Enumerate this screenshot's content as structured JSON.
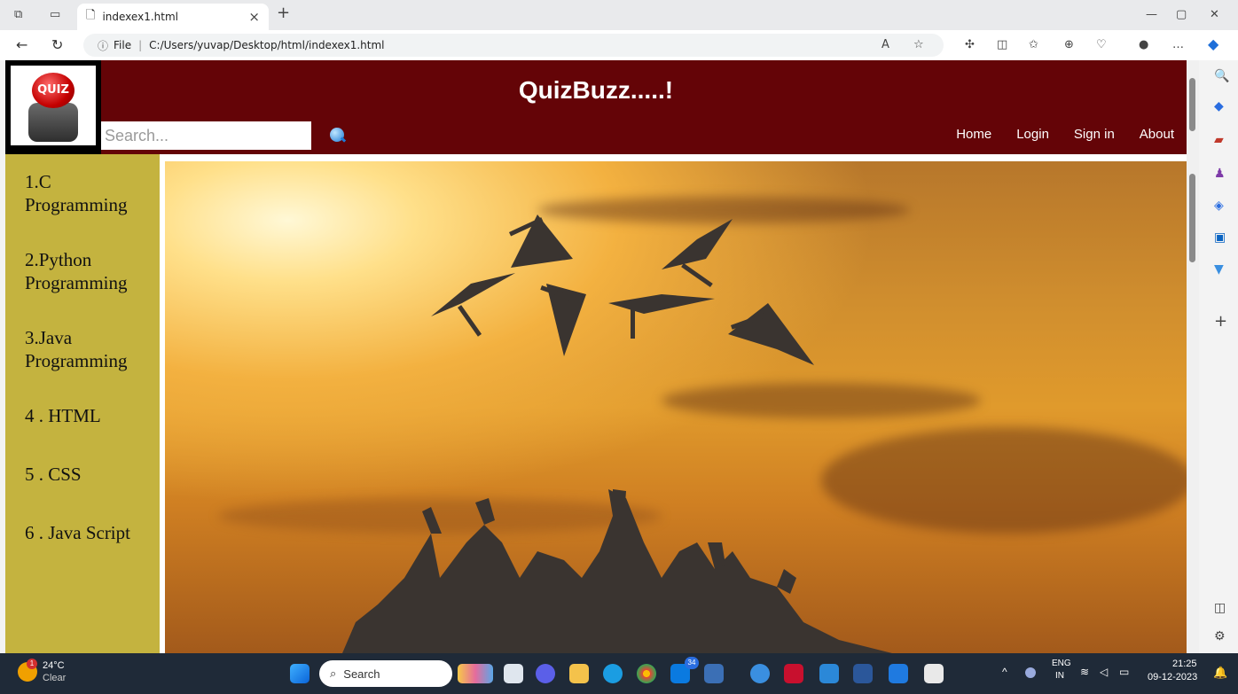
{
  "browser": {
    "tab_title": "indexex1.html",
    "tab_close": "×",
    "new_tab": "+",
    "url_prefix": "File",
    "url": "C:/Users/yuvap/Desktop/html/indexex1.html"
  },
  "header": {
    "logo_text": "QUIZ",
    "title": "QuizBuzz.....!",
    "search_placeholder": "Search...",
    "nav": [
      "Home",
      "Login",
      "Sign in",
      "About"
    ]
  },
  "sidebar": {
    "items": [
      "1.C Programming",
      "2.Python Programming",
      "3.Java Programming",
      "4 . HTML",
      "5 . CSS",
      "6 . Java Script"
    ]
  },
  "taskbar": {
    "weather_temp": "24°C",
    "weather_desc": "Clear",
    "weather_badge": "1",
    "search_label": "Search",
    "lang_top": "ENG",
    "lang_bottom": "IN",
    "time": "21:25",
    "date": "09-12-2023",
    "badge_count": "34"
  }
}
